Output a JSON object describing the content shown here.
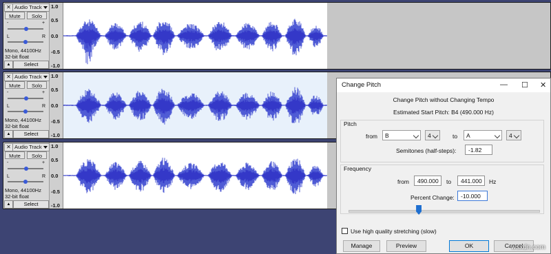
{
  "colors": {
    "waveform_outer": "#4f5bd5",
    "waveform_inner": "#3438c8",
    "selected_bg": "#e8f1fb",
    "desktop": "#3d4473"
  },
  "tracks": [
    {
      "close": "✕",
      "name": "Audio Track",
      "mute": "Mute",
      "solo": "Solo",
      "gain_minus": "-",
      "gain_plus": "+",
      "pan_left": "L",
      "pan_right": "R",
      "rate": "Mono, 44100Hz",
      "format": "32-bit float",
      "collapse": "▲",
      "select": "Select",
      "scale_top": "1.0",
      "scale_mid": "0.0",
      "scale_upper": "0.5",
      "scale_lower": "-0.5",
      "scale_bottom": "-1.0",
      "selected": false
    },
    {
      "close": "✕",
      "name": "Audio Track",
      "mute": "Mute",
      "solo": "Solo",
      "gain_minus": "-",
      "gain_plus": "+",
      "pan_left": "L",
      "pan_right": "R",
      "rate": "Mono, 44100Hz",
      "format": "32-bit float",
      "collapse": "▲",
      "select": "Select",
      "scale_top": "1.0",
      "scale_mid": "0.0",
      "scale_upper": "0.5",
      "scale_lower": "-0.5",
      "scale_bottom": "-1.0",
      "selected": true
    },
    {
      "close": "✕",
      "name": "Audio Track",
      "mute": "Mute",
      "solo": "Solo",
      "gain_minus": "-",
      "gain_plus": "+",
      "pan_left": "L",
      "pan_right": "R",
      "rate": "Mono, 44100Hz",
      "format": "32-bit float",
      "collapse": "▲",
      "select": "Select",
      "scale_top": "1.0",
      "scale_mid": "0.0",
      "scale_upper": "0.5",
      "scale_lower": "-0.5",
      "scale_bottom": "-1.0",
      "selected": false
    }
  ],
  "dialog": {
    "title": "Change Pitch",
    "controls": {
      "minimize": "—",
      "maximize": "☐",
      "close": "✕"
    },
    "heading": "Change Pitch without Changing Tempo",
    "estimated": "Estimated Start Pitch: B4 (490.000 Hz)",
    "pitch": {
      "group_label": "Pitch",
      "from_label": "from",
      "from_note": "B",
      "from_octave": "4",
      "to_label": "to",
      "to_note": "A",
      "to_octave": "4",
      "semitones_label": "Semitones (half-steps):",
      "semitones_value": "-1.82"
    },
    "frequency": {
      "group_label": "Frequency",
      "from_label": "from",
      "from_value": "490.000",
      "to_label": "to",
      "to_value": "441.000",
      "unit": "Hz",
      "percent_label": "Percent Change:",
      "percent_value": "-10.000",
      "slider_fraction": 0.37
    },
    "checkbox_label": "Use high quality stretching (slow)",
    "checkbox_checked": false,
    "buttons": {
      "manage": "Manage",
      "preview": "Preview",
      "ok": "OK",
      "cancel": "Cancel"
    }
  },
  "watermark": "wsxdn.com"
}
